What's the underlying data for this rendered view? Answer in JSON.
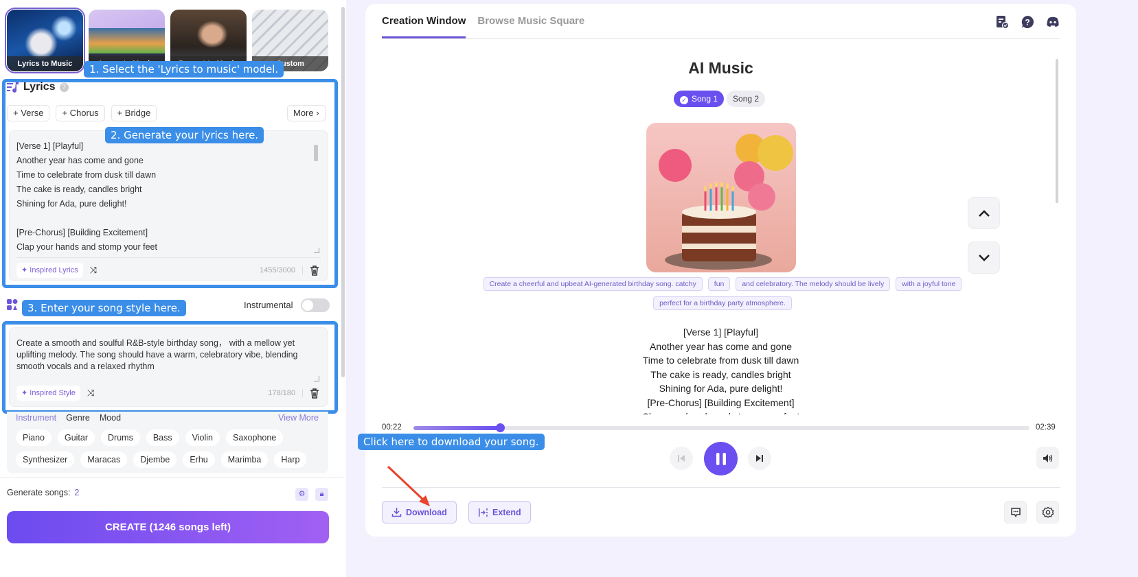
{
  "models": [
    {
      "label": "Lyrics to Music",
      "active": true
    },
    {
      "label": "Image to Music",
      "active": false
    },
    {
      "label": "Prompt to Music",
      "active": false
    },
    {
      "label": "Custom",
      "active": false
    }
  ],
  "annotations": {
    "step1": "1. Select the 'Lyrics to music' model.",
    "step2": "2. Generate your lyrics here.",
    "step3": "3. Enter your song style here.",
    "download_tip": "Click here to download your song."
  },
  "lyrics": {
    "title": "Lyrics",
    "help_icon": "question-icon",
    "add_buttons": [
      "+ Verse",
      "+ Chorus",
      "+ Bridge"
    ],
    "more_label": "More",
    "text": "[Verse 1] [Playful]\nAnother year has come and gone\nTime to celebrate from dusk till dawn\nThe cake is ready, candles bright\nShining for Ada, pure delight!\n\n[Pre-Chorus] [Building Excitement]\nClap your hands and stomp your feet",
    "inspired_label": "Inspired Lyrics",
    "count": "1455/3000"
  },
  "style": {
    "instrumental_label": "Instrumental",
    "instrumental_on": false,
    "text": "Create a smooth and soulful R&B-style birthday song， with a mellow yet uplifting melody. The song should have a warm, celebratory vibe, blending smooth vocals and a relaxed rhythm",
    "inspired_label": "Inspired Style",
    "count": "178/180"
  },
  "tag_panel": {
    "tabs": [
      "Instrument",
      "Genre",
      "Mood"
    ],
    "active_tab": "Instrument",
    "view_more": "View More",
    "row1": [
      "Piano",
      "Guitar",
      "Drums",
      "Bass",
      "Violin",
      "Saxophone"
    ],
    "row2": [
      "Synthesizer",
      "Maracas",
      "Djembe",
      "Erhu",
      "Marimba",
      "Harp"
    ]
  },
  "generate": {
    "label": "Generate songs:",
    "value": "2"
  },
  "create_button": "CREATE (1246 songs left)",
  "right": {
    "tabs": [
      {
        "label": "Creation Window",
        "active": true
      },
      {
        "label": "Browse Music Square",
        "active": false
      }
    ],
    "title": "AI Music",
    "songs": [
      {
        "label": "Song 1",
        "active": true
      },
      {
        "label": "Song 2",
        "active": false
      }
    ],
    "prompt_tags": [
      "Create a cheerful and upbeat AI-generated birthday song. catchy",
      "fun",
      "and celebratory. The melody should be lively",
      "with a joyful tone",
      "perfect for a birthday party atmosphere."
    ],
    "lyrics_lines": [
      "[Verse 1] [Playful]",
      "Another year has come and gone",
      "Time to celebrate from dusk till dawn",
      "The cake is ready, candles bright",
      "Shining for Ada, pure delight!",
      "[Pre-Chorus] [Building Excitement]",
      "Clap your hands and stomp your feet"
    ],
    "player": {
      "current_time": "00:22",
      "total_time": "02:39",
      "progress_fraction": 0.14,
      "state": "playing"
    },
    "download_label": "Download",
    "extend_label": "Extend"
  },
  "colors": {
    "accent": "#6b4ff0",
    "annotation": "#3b8ee8",
    "arrow": "#e8432c"
  }
}
